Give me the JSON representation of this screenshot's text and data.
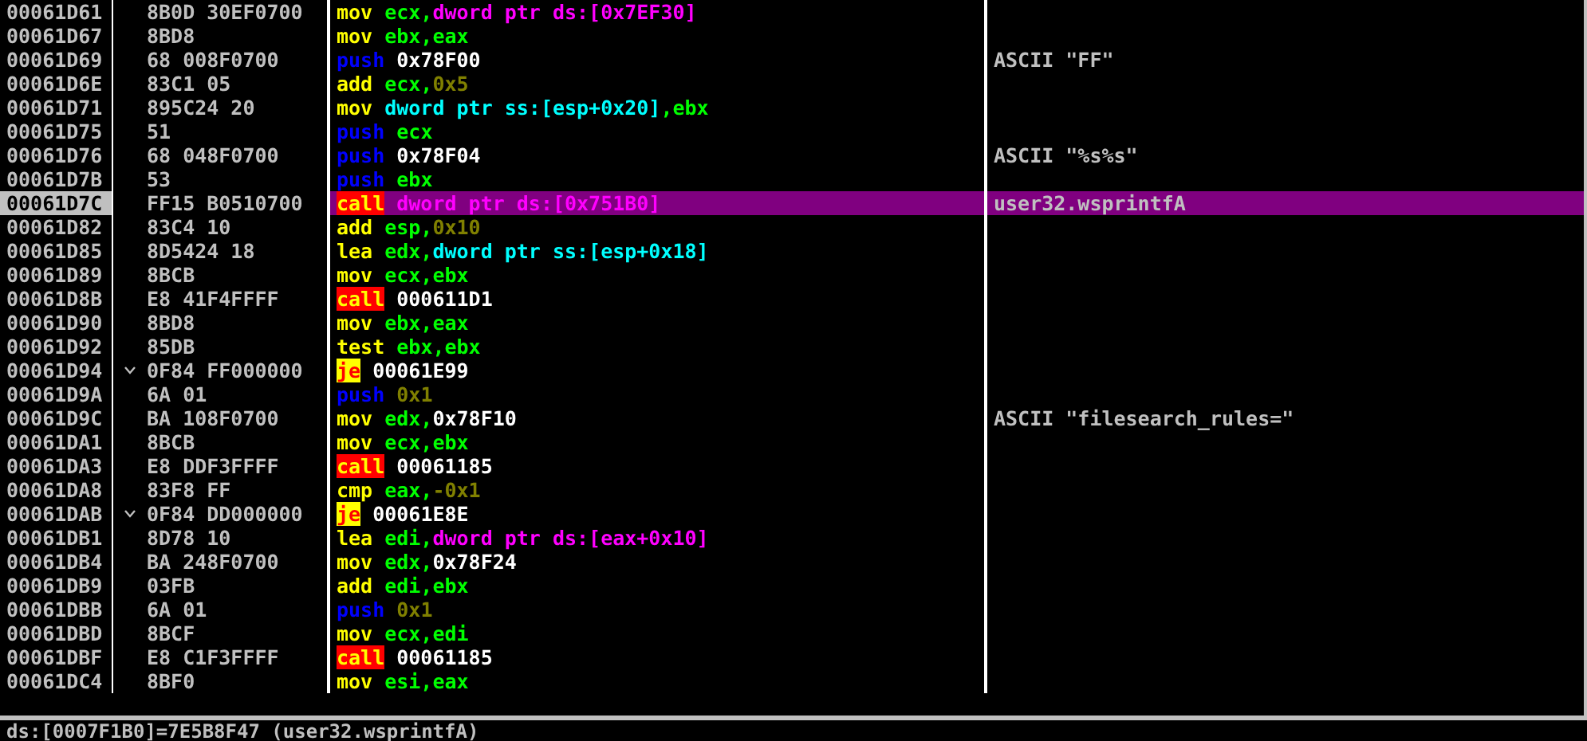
{
  "rows": [
    {
      "address": "00061D61",
      "hex": "8B0D 30EF0700",
      "jump_arrow": false,
      "selected": false,
      "instruction": [
        {
          "kind": "op",
          "text": "mov "
        },
        {
          "kind": "reg",
          "text": "ecx,"
        },
        {
          "kind": "mem",
          "text": "dword ptr ds:[0x7EF30]"
        }
      ],
      "comment": ""
    },
    {
      "address": "00061D67",
      "hex": "8BD8",
      "jump_arrow": false,
      "selected": false,
      "instruction": [
        {
          "kind": "op",
          "text": "mov "
        },
        {
          "kind": "reg",
          "text": "ebx,eax"
        }
      ],
      "comment": ""
    },
    {
      "address": "00061D69",
      "hex": "68 008F0700",
      "jump_arrow": false,
      "selected": false,
      "instruction": [
        {
          "kind": "push",
          "text": "push "
        },
        {
          "kind": "addr",
          "text": "0x78F00"
        }
      ],
      "comment": "ASCII \"FF\""
    },
    {
      "address": "00061D6E",
      "hex": "83C1 05",
      "jump_arrow": false,
      "selected": false,
      "instruction": [
        {
          "kind": "op",
          "text": "add "
        },
        {
          "kind": "reg",
          "text": "ecx,"
        },
        {
          "kind": "const",
          "text": "0x5"
        }
      ],
      "comment": ""
    },
    {
      "address": "00061D71",
      "hex": "895C24 20",
      "jump_arrow": false,
      "selected": false,
      "instruction": [
        {
          "kind": "op",
          "text": "mov "
        },
        {
          "kind": "stack",
          "text": "dword ptr ss:[esp+0x20]"
        },
        {
          "kind": "reg",
          "text": ",ebx"
        }
      ],
      "comment": ""
    },
    {
      "address": "00061D75",
      "hex": "51",
      "jump_arrow": false,
      "selected": false,
      "instruction": [
        {
          "kind": "push",
          "text": "push "
        },
        {
          "kind": "reg",
          "text": "ecx"
        }
      ],
      "comment": ""
    },
    {
      "address": "00061D76",
      "hex": "68 048F0700",
      "jump_arrow": false,
      "selected": false,
      "instruction": [
        {
          "kind": "push",
          "text": "push "
        },
        {
          "kind": "addr",
          "text": "0x78F04"
        }
      ],
      "comment": "ASCII \"%s%s\""
    },
    {
      "address": "00061D7B",
      "hex": "53",
      "jump_arrow": false,
      "selected": false,
      "instruction": [
        {
          "kind": "push",
          "text": "push "
        },
        {
          "kind": "reg",
          "text": "ebx"
        }
      ],
      "comment": ""
    },
    {
      "address": "00061D7C",
      "hex": "FF15 B0510700",
      "jump_arrow": false,
      "selected": true,
      "instruction": [
        {
          "kind": "call",
          "text": "call"
        },
        {
          "kind": "mem",
          "text": " dword ptr ds:[0x751B0]"
        }
      ],
      "comment": "user32.wsprintfA"
    },
    {
      "address": "00061D82",
      "hex": "83C4 10",
      "jump_arrow": false,
      "selected": false,
      "instruction": [
        {
          "kind": "op",
          "text": "add "
        },
        {
          "kind": "reg",
          "text": "esp,"
        },
        {
          "kind": "const",
          "text": "0x10"
        }
      ],
      "comment": ""
    },
    {
      "address": "00061D85",
      "hex": "8D5424 18",
      "jump_arrow": false,
      "selected": false,
      "instruction": [
        {
          "kind": "op",
          "text": "lea "
        },
        {
          "kind": "reg",
          "text": "edx,"
        },
        {
          "kind": "stack",
          "text": "dword ptr ss:[esp+0x18]"
        }
      ],
      "comment": ""
    },
    {
      "address": "00061D89",
      "hex": "8BCB",
      "jump_arrow": false,
      "selected": false,
      "instruction": [
        {
          "kind": "op",
          "text": "mov "
        },
        {
          "kind": "reg",
          "text": "ecx,ebx"
        }
      ],
      "comment": ""
    },
    {
      "address": "00061D8B",
      "hex": "E8 41F4FFFF",
      "jump_arrow": false,
      "selected": false,
      "instruction": [
        {
          "kind": "call",
          "text": "call"
        },
        {
          "kind": "addr",
          "text": " 000611D1"
        }
      ],
      "comment": ""
    },
    {
      "address": "00061D90",
      "hex": "8BD8",
      "jump_arrow": false,
      "selected": false,
      "instruction": [
        {
          "kind": "op",
          "text": "mov "
        },
        {
          "kind": "reg",
          "text": "ebx,eax"
        }
      ],
      "comment": ""
    },
    {
      "address": "00061D92",
      "hex": "85DB",
      "jump_arrow": false,
      "selected": false,
      "instruction": [
        {
          "kind": "op",
          "text": "test "
        },
        {
          "kind": "reg",
          "text": "ebx,ebx"
        }
      ],
      "comment": ""
    },
    {
      "address": "00061D94",
      "hex": "0F84 FF000000",
      "jump_arrow": true,
      "selected": false,
      "instruction": [
        {
          "kind": "jump",
          "text": "je"
        },
        {
          "kind": "addr",
          "text": " 00061E99"
        }
      ],
      "comment": ""
    },
    {
      "address": "00061D9A",
      "hex": "6A 01",
      "jump_arrow": false,
      "selected": false,
      "instruction": [
        {
          "kind": "push",
          "text": "push "
        },
        {
          "kind": "const",
          "text": "0x1"
        }
      ],
      "comment": ""
    },
    {
      "address": "00061D9C",
      "hex": "BA 108F0700",
      "jump_arrow": false,
      "selected": false,
      "instruction": [
        {
          "kind": "op",
          "text": "mov "
        },
        {
          "kind": "reg",
          "text": "edx,"
        },
        {
          "kind": "addr",
          "text": "0x78F10"
        }
      ],
      "comment": "ASCII \"filesearch_rules=\""
    },
    {
      "address": "00061DA1",
      "hex": "8BCB",
      "jump_arrow": false,
      "selected": false,
      "instruction": [
        {
          "kind": "op",
          "text": "mov "
        },
        {
          "kind": "reg",
          "text": "ecx,ebx"
        }
      ],
      "comment": ""
    },
    {
      "address": "00061DA3",
      "hex": "E8 DDF3FFFF",
      "jump_arrow": false,
      "selected": false,
      "instruction": [
        {
          "kind": "call",
          "text": "call"
        },
        {
          "kind": "addr",
          "text": " 00061185"
        }
      ],
      "comment": ""
    },
    {
      "address": "00061DA8",
      "hex": "83F8 FF",
      "jump_arrow": false,
      "selected": false,
      "instruction": [
        {
          "kind": "op",
          "text": "cmp "
        },
        {
          "kind": "reg",
          "text": "eax,"
        },
        {
          "kind": "const",
          "text": "-0x1"
        }
      ],
      "comment": ""
    },
    {
      "address": "00061DAB",
      "hex": "0F84 DD000000",
      "jump_arrow": true,
      "selected": false,
      "instruction": [
        {
          "kind": "jump",
          "text": "je"
        },
        {
          "kind": "addr",
          "text": " 00061E8E"
        }
      ],
      "comment": ""
    },
    {
      "address": "00061DB1",
      "hex": "8D78 10",
      "jump_arrow": false,
      "selected": false,
      "instruction": [
        {
          "kind": "op",
          "text": "lea "
        },
        {
          "kind": "reg",
          "text": "edi,"
        },
        {
          "kind": "mem",
          "text": "dword ptr ds:[eax+0x10]"
        }
      ],
      "comment": ""
    },
    {
      "address": "00061DB4",
      "hex": "BA 248F0700",
      "jump_arrow": false,
      "selected": false,
      "instruction": [
        {
          "kind": "op",
          "text": "mov "
        },
        {
          "kind": "reg",
          "text": "edx,"
        },
        {
          "kind": "addr",
          "text": "0x78F24"
        }
      ],
      "comment": ""
    },
    {
      "address": "00061DB9",
      "hex": "03FB",
      "jump_arrow": false,
      "selected": false,
      "instruction": [
        {
          "kind": "op",
          "text": "add "
        },
        {
          "kind": "reg",
          "text": "edi,ebx"
        }
      ],
      "comment": ""
    },
    {
      "address": "00061DBB",
      "hex": "6A 01",
      "jump_arrow": false,
      "selected": false,
      "instruction": [
        {
          "kind": "push",
          "text": "push "
        },
        {
          "kind": "const",
          "text": "0x1"
        }
      ],
      "comment": ""
    },
    {
      "address": "00061DBD",
      "hex": "8BCF",
      "jump_arrow": false,
      "selected": false,
      "instruction": [
        {
          "kind": "op",
          "text": "mov "
        },
        {
          "kind": "reg",
          "text": "ecx,edi"
        }
      ],
      "comment": ""
    },
    {
      "address": "00061DBF",
      "hex": "E8 C1F3FFFF",
      "jump_arrow": false,
      "selected": false,
      "instruction": [
        {
          "kind": "call",
          "text": "call"
        },
        {
          "kind": "addr",
          "text": " 00061185"
        }
      ],
      "comment": ""
    },
    {
      "address": "00061DC4",
      "hex": "8BF0",
      "jump_arrow": false,
      "selected": false,
      "instruction": [
        {
          "kind": "op",
          "text": "mov "
        },
        {
          "kind": "reg",
          "text": "esi,eax"
        }
      ],
      "comment": ""
    }
  ],
  "status_bar": "ds:[0007F1B0]=7E5B8F47 (user32.wsprintfA)"
}
